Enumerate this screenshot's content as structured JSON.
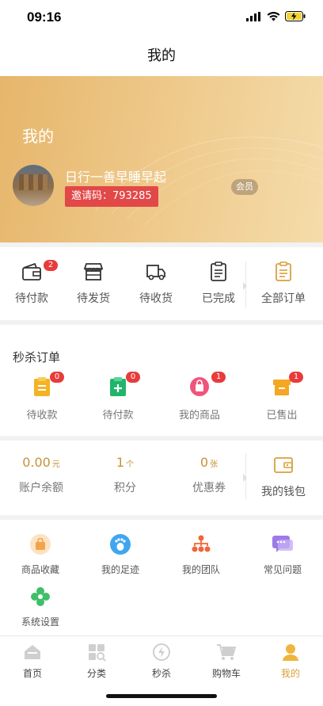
{
  "status": {
    "time": "09:16"
  },
  "nav": {
    "title": "我的"
  },
  "profile": {
    "title": "我的",
    "username": "日行一善早睡早起",
    "invite_label": "邀请码：",
    "invite_code": "793285",
    "member_label": "会员"
  },
  "orders": {
    "items": [
      {
        "label": "待付款",
        "icon": "wallet-icon",
        "badge": "2"
      },
      {
        "label": "待发货",
        "icon": "shop-icon"
      },
      {
        "label": "待收货",
        "icon": "truck-icon"
      },
      {
        "label": "已完成",
        "icon": "clipboard-check-icon"
      }
    ],
    "all_label": "全部订单"
  },
  "seckill": {
    "title": "秒杀订单",
    "items": [
      {
        "label": "待收款",
        "badge": "0",
        "color": "#f5b324"
      },
      {
        "label": "待付款",
        "badge": "0",
        "color": "#21b56b"
      },
      {
        "label": "我的商品",
        "badge": "1",
        "color": "#f0557b"
      },
      {
        "label": "已售出",
        "badge": "1",
        "color": "#f5a623"
      }
    ]
  },
  "wallet": {
    "balance": {
      "value": "0.00",
      "unit": "元",
      "label": "账户余额"
    },
    "points": {
      "value": "1",
      "unit": "个",
      "label": "积分"
    },
    "coupons": {
      "value": "0",
      "unit": "张",
      "label": "优惠券"
    },
    "my_wallet_label": "我的钱包"
  },
  "tools": [
    {
      "label": "商品收藏",
      "color": "#f5a34a"
    },
    {
      "label": "我的足迹",
      "color": "#3fa6ef"
    },
    {
      "label": "我的团队",
      "color": "#f0663a"
    },
    {
      "label": "常见问题",
      "color": "#9c7be8"
    },
    {
      "label": "系统设置",
      "color": "#3fbf6a"
    }
  ],
  "tabbar": [
    {
      "label": "首页"
    },
    {
      "label": "分类"
    },
    {
      "label": "秒杀"
    },
    {
      "label": "购物车"
    },
    {
      "label": "我的",
      "active": true
    }
  ],
  "colors": {
    "accent": "#d9a03c",
    "badge": "#e83b3b",
    "invite_bg": "#e24848"
  }
}
